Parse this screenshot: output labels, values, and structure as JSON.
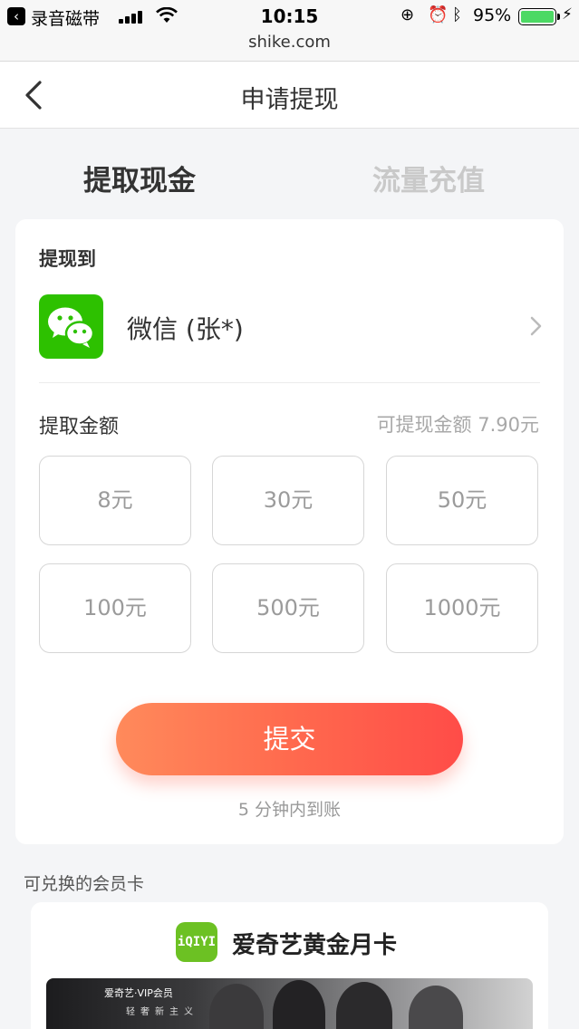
{
  "status_bar": {
    "back_app": "录音磁带",
    "time": "10:15",
    "battery": "95%",
    "url": "shike.com"
  },
  "nav": {
    "title": "申请提现"
  },
  "tabs": [
    {
      "label": "提取现金",
      "active": true
    },
    {
      "label": "流量充值",
      "active": false
    }
  ],
  "withdraw": {
    "to_label": "提现到",
    "account": "微信 (张*)",
    "amount_label": "提取金额",
    "available": "可提现金额 7.90元",
    "options": [
      "8元",
      "30元",
      "50元",
      "100元",
      "500元",
      "1000元"
    ],
    "submit": "提交",
    "hint": "5 分钟内到账"
  },
  "membership": {
    "section_label": "可兑换的会员卡",
    "card_title": "爱奇艺黄金月卡",
    "logo_text": "iQIYI",
    "banner_brand": "爱奇艺·VIP会员",
    "banner_tag": "轻奢新主义"
  },
  "colors": {
    "accent": "#ff5a4c",
    "wechat": "#2dc100",
    "iqiyi": "#6cc123"
  }
}
